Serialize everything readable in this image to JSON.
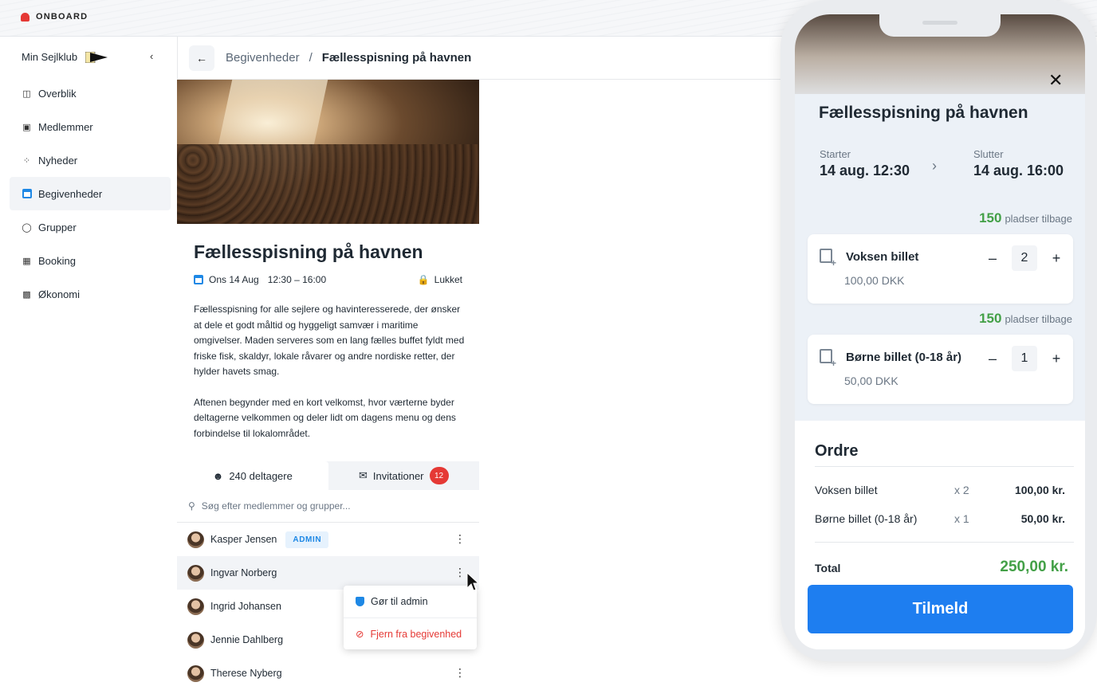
{
  "brand": {
    "name": "ONBOARD"
  },
  "sidebar": {
    "club_name": "Min Sejlklub",
    "collapse_icon": "chevron-left-icon",
    "items": [
      {
        "label": "Overblik",
        "icon": "dashboard-icon"
      },
      {
        "label": "Medlemmer",
        "icon": "members-icon"
      },
      {
        "label": "Nyheder",
        "icon": "rss-icon"
      },
      {
        "label": "Begivenheder",
        "icon": "calendar-icon",
        "active": true
      },
      {
        "label": "Grupper",
        "icon": "groups-icon"
      },
      {
        "label": "Booking",
        "icon": "ticket-icon"
      },
      {
        "label": "Økonomi",
        "icon": "money-icon"
      }
    ]
  },
  "header": {
    "breadcrumb_parent": "Begivenheder",
    "breadcrumb_sep": "/",
    "breadcrumb_current": "Fællesspisning på havnen"
  },
  "event": {
    "title": "Fællesspisning på havnen",
    "date": "Ons 14 Aug",
    "time": "12:30 – 16:00",
    "status": "Lukket",
    "description_1": "Fællesspisning for alle sejlere og havinteresserede, der ønsker at dele et godt måltid og hyggeligt samvær i maritime omgivelser. Maden serveres som en lang fælles buffet fyldt med friske fisk, skaldyr, lokale råvarer og andre nordiske retter, der hylder havets smag.",
    "description_2": "Aftenen begynder med en kort velkomst, hvor værterne byder deltagerne velkommen og deler lidt om dagens menu og dens forbindelse til lokalområdet."
  },
  "tabs": {
    "participants": "240 deltagere",
    "invitations": "Invitationer",
    "invitations_count": "12"
  },
  "search": {
    "placeholder": "Søg efter medlemmer og grupper..."
  },
  "members": [
    {
      "name": "Kasper Jensen",
      "badge": "ADMIN"
    },
    {
      "name": "Ingvar Norberg"
    },
    {
      "name": "Ingrid Johansen"
    },
    {
      "name": "Jennie Dahlberg"
    },
    {
      "name": "Therese Nyberg"
    }
  ],
  "context_menu": {
    "make_admin": "Gør til admin",
    "remove": "Fjern fra begivenhed"
  },
  "mobile": {
    "title": "Fællesspisning på havnen",
    "start_label": "Starter",
    "start_value": "14 aug. 12:30",
    "end_label": "Slutter",
    "end_value": "14 aug. 16:00",
    "tickets": [
      {
        "seats_count": "150",
        "seats_label": "pladser tilbage",
        "name": "Voksen billet",
        "price": "100,00 DKK",
        "qty": "2"
      },
      {
        "seats_count": "150",
        "seats_label": "pladser tilbage",
        "name": "Børne billet (0-18 år)",
        "price": "50,00 DKK",
        "qty": "1"
      }
    ],
    "stepper_minus": "–",
    "stepper_plus": "+",
    "order": {
      "title": "Ordre",
      "rows": [
        {
          "name": "Voksen billet",
          "qty": "x 2",
          "price": "100,00 kr."
        },
        {
          "name": "Børne billet (0-18 år)",
          "qty": "x 1",
          "price": "50,00 kr."
        }
      ],
      "total_label": "Total",
      "total_value": "250,00 kr."
    },
    "cta": "Tilmeld"
  },
  "colors": {
    "accent": "#1e7ef0",
    "danger": "#e53935",
    "success": "#43a047"
  }
}
